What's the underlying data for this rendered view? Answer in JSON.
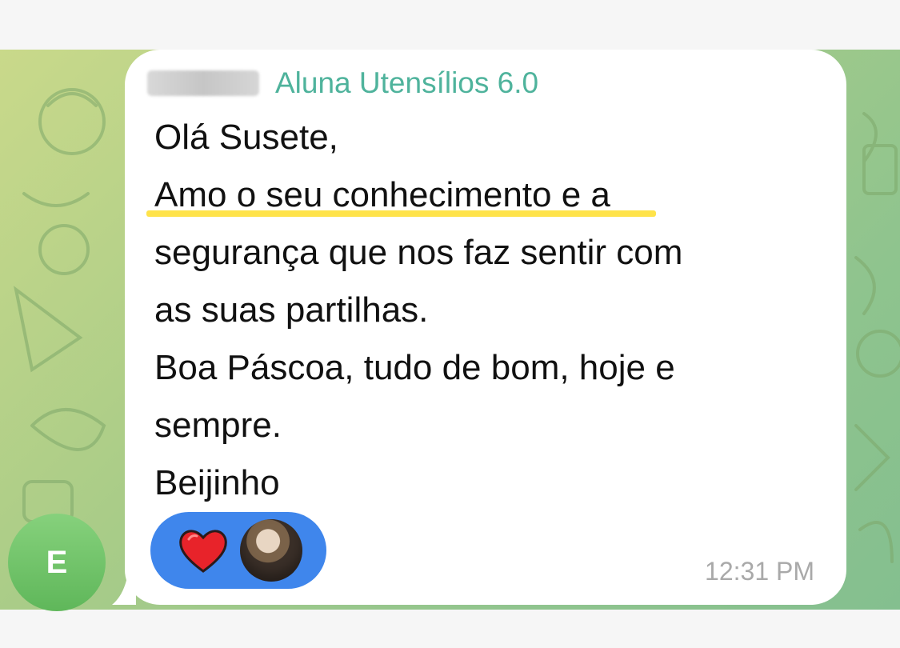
{
  "sender": {
    "name": "Aluna Utensílios 6.0",
    "avatar_initial": "E",
    "name_color": "#4fb39c"
  },
  "message": {
    "lines": [
      "Olá Susete,",
      "Amo o seu conhecimento e a",
      "segurança que nos faz sentir com",
      "as suas partilhas.",
      "Boa Páscoa, tudo de bom, hoje e",
      "sempre.",
      "Beijinho"
    ],
    "time": "12:31 PM",
    "highlight_color": "#ffe34a"
  },
  "reactions": {
    "emoji_icon": "heart-icon",
    "pill_color": "#3f86ec"
  }
}
